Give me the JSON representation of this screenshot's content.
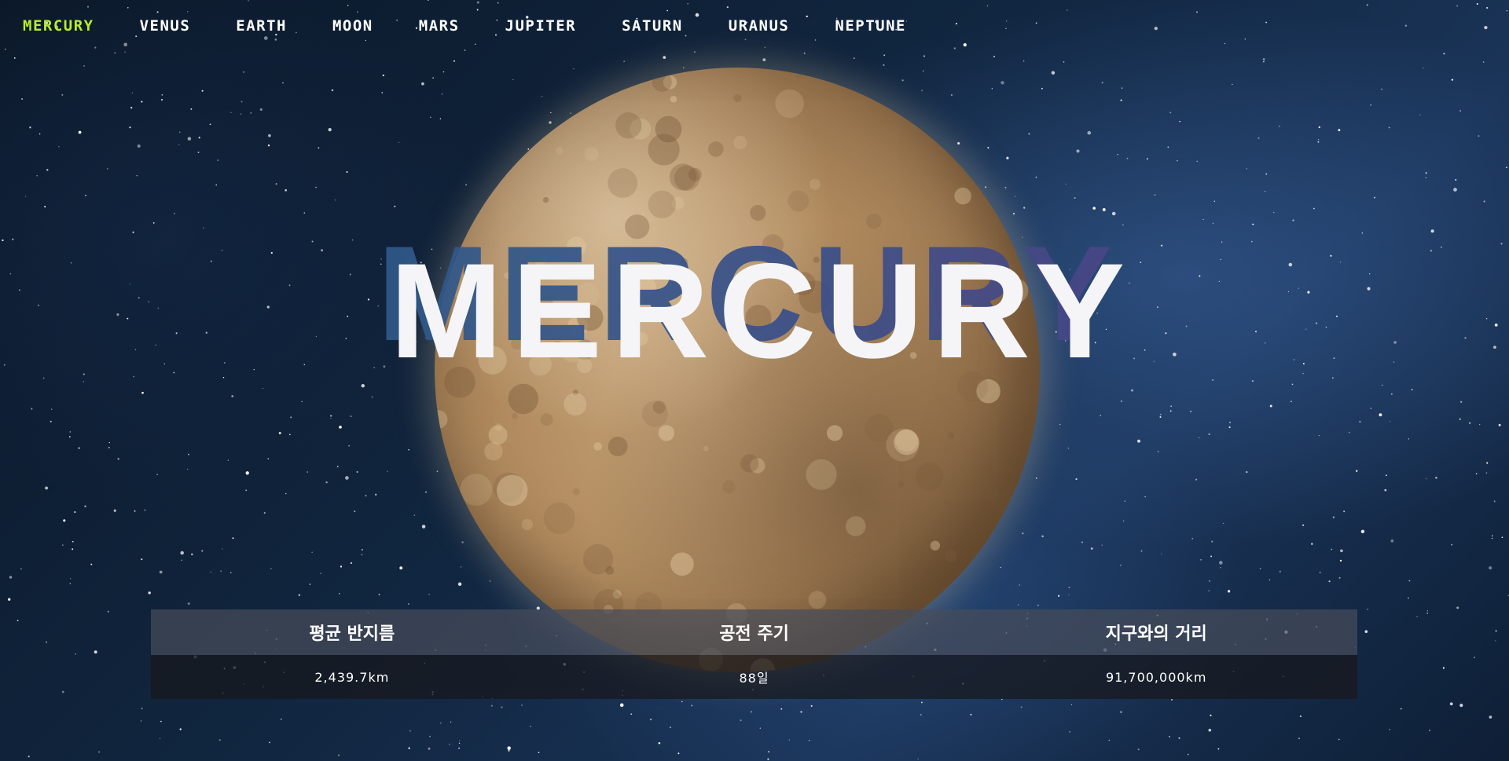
{
  "nav": {
    "items": [
      {
        "label": "MERCURY",
        "active": true
      },
      {
        "label": "VENUS",
        "active": false
      },
      {
        "label": "EARTH",
        "active": false
      },
      {
        "label": "MOON",
        "active": false
      },
      {
        "label": "MARS",
        "active": false
      },
      {
        "label": "JUPITER",
        "active": false
      },
      {
        "label": "SATURN",
        "active": false
      },
      {
        "label": "URANUS",
        "active": false
      },
      {
        "label": "NEPTUNE",
        "active": false
      }
    ],
    "active_color": "#b9ec2f"
  },
  "hero": {
    "title": "MERCURY",
    "planet_image": "mercury-planet"
  },
  "stats": {
    "headers": [
      "평균 반지름",
      "공전 주기",
      "지구와의 거리"
    ],
    "values": [
      "2,439.7km",
      "88일",
      "91,700,000km"
    ]
  }
}
